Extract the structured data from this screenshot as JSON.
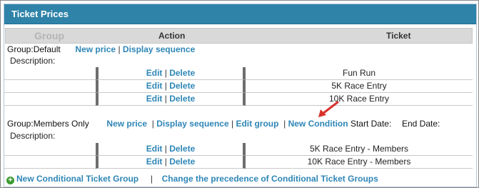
{
  "panel": {
    "title": "Ticket Prices"
  },
  "header": {
    "group": "Group",
    "action": "Action",
    "ticket": "Ticket"
  },
  "groups": [
    {
      "group_label": "Group:",
      "group_name": "Default",
      "new_price": "New price",
      "display_sequence": "Display sequence",
      "description_label": "Description:",
      "tickets": [
        {
          "edit": "Edit",
          "delete": "Delete",
          "ticket": "Fun Run"
        },
        {
          "edit": "Edit",
          "delete": "Delete",
          "ticket": "5K Race Entry"
        },
        {
          "edit": "Edit",
          "delete": "Delete",
          "ticket": "10K Race Entry"
        }
      ]
    },
    {
      "group_label": "Group:",
      "group_name": "Members Only",
      "new_price": "New price",
      "display_sequence": "Display sequence",
      "edit_group": "Edit group",
      "new_condition": "New Condition",
      "start_date_label": "Start Date:",
      "end_date_label": "End Date:",
      "description_label": "Description:",
      "tickets": [
        {
          "edit": "Edit",
          "delete": "Delete",
          "ticket": "5K Race Entry - Members"
        },
        {
          "edit": "Edit",
          "delete": "Delete",
          "ticket": "10K Race Entry - Members"
        }
      ]
    }
  ],
  "footer": {
    "new_conditional_group": "New Conditional Ticket Group",
    "change_precedence": "Change the precedence of Conditional Ticket Groups"
  },
  "colors": {
    "title_bar": "#2f83a8",
    "link": "#2e86b6",
    "arrow": "#d9322b",
    "plus_icon": "#3b9a2e"
  },
  "icons": {
    "plus": "plus-circle-icon",
    "pointer": "red-arrow-icon"
  }
}
